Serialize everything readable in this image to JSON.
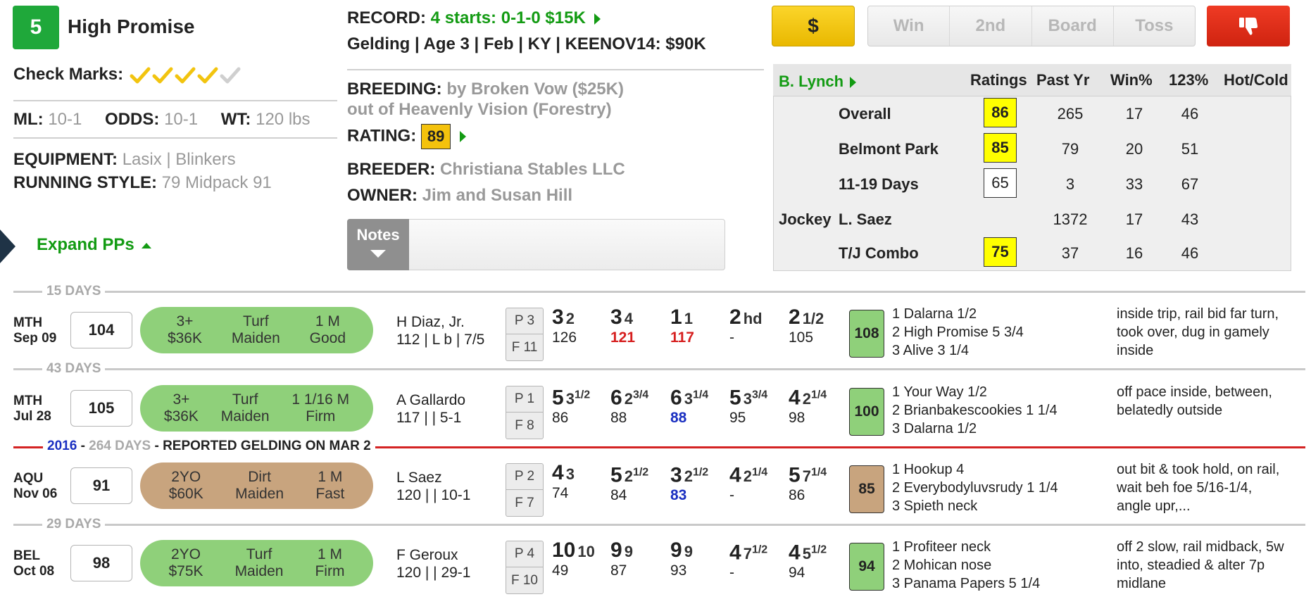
{
  "horse": {
    "program_number": "5",
    "name": "High Promise",
    "check_marks_label": "Check Marks:",
    "ml_label": "ML:",
    "ml": "10-1",
    "odds_label": "ODDS:",
    "odds": "10-1",
    "wt_label": "WT:",
    "wt": "120 lbs",
    "equipment_label": "EQUIPMENT:",
    "equipment": "Lasix | Blinkers",
    "running_style_label": "RUNNING STYLE:",
    "running_style": "79 Midpack 91",
    "expand_label": "Expand PPs"
  },
  "info": {
    "record_label": "RECORD:",
    "record": "4 starts: 0-1-0 $15K",
    "summary": "Gelding | Age 3 | Feb | KY | KEENOV14: $90K",
    "breeding_label": "BREEDING:",
    "breeding_1": "by Broken Vow ($25K)",
    "breeding_2": "out of Heavenly Vision (Forestry)",
    "rating_label": "RATING:",
    "rating": "89",
    "breeder_label": "BREEDER:",
    "breeder": "Christiana Stables LLC",
    "owner_label": "OWNER:",
    "owner": "Jim and Susan Hill",
    "notes_label": "Notes"
  },
  "buttons": {
    "dollar": "$",
    "win": "Win",
    "second": "2nd",
    "board": "Board",
    "toss": "Toss"
  },
  "trainer_panel": {
    "trainer": "B. Lynch",
    "headers": [
      "Ratings",
      "Past Yr",
      "Win%",
      "123%",
      "Hot/Cold"
    ],
    "rows": [
      {
        "label": "Overall",
        "rating": "86",
        "past_yr": "265",
        "win": "17",
        "itm": "46"
      },
      {
        "label": "Belmont Park",
        "rating": "85",
        "past_yr": "79",
        "win": "20",
        "itm": "51"
      },
      {
        "label": "11-19 Days",
        "rating": "65",
        "past_yr": "3",
        "win": "33",
        "itm": "67"
      },
      {
        "prefix": "Jockey",
        "label": "L. Saez",
        "rating": "",
        "past_yr": "1372",
        "win": "17",
        "itm": "43"
      },
      {
        "label": "T/J Combo",
        "rating": "75",
        "past_yr": "37",
        "win": "16",
        "itm": "46"
      }
    ]
  },
  "separators": {
    "s1": "15 DAYS",
    "s2": "43 DAYS",
    "year": "2016",
    "dash": "-",
    "s3_days": "264 DAYS",
    "s3_note": "- REPORTED GELDING ON MAR 2",
    "s4": "29 DAYS"
  },
  "races": [
    {
      "track": "MTH",
      "date": "Sep 09",
      "speed": "104",
      "pill": {
        "age": "3+",
        "purse": "$36K",
        "surface": "Turf",
        "type": "Maiden",
        "dist": "1 M",
        "cond": "Good"
      },
      "jockey": "H Diaz, Jr.",
      "weight_line": "112 | L b | 7/5",
      "post": "P 3",
      "field": "F 11",
      "calls": [
        {
          "pos": "3",
          "len": "2",
          "fig": "126"
        },
        {
          "pos": "3",
          "len": "4",
          "fig": "121"
        },
        {
          "pos": "1",
          "len": "1",
          "fig": "117"
        },
        {
          "pos": "2",
          "len": "hd",
          "fig": "-"
        },
        {
          "pos": "2",
          "len": "1/2",
          "fig": "105"
        }
      ],
      "figure": "108",
      "finish": [
        "1 Dalarna 1/2",
        "2 High Promise 5 3/4",
        "3 Alive 3 1/4"
      ],
      "comment": "inside trip, rail bid far turn, took over, dug in gamely inside"
    },
    {
      "track": "MTH",
      "date": "Jul 28",
      "speed": "105",
      "pill": {
        "age": "3+",
        "purse": "$36K",
        "surface": "Turf",
        "type": "Maiden",
        "dist": "1 1/16 M",
        "cond": "Firm"
      },
      "jockey": "A Gallardo",
      "weight_line": "117 | | 5-1",
      "post": "P 1",
      "field": "F 8",
      "calls": [
        {
          "pos": "5",
          "len": "3 1/2",
          "fig": "86"
        },
        {
          "pos": "6",
          "len": "2 3/4",
          "fig": "88"
        },
        {
          "pos": "6",
          "len": "3 1/4",
          "fig": "88"
        },
        {
          "pos": "5",
          "len": "3 3/4",
          "fig": "95"
        },
        {
          "pos": "4",
          "len": "2 1/4",
          "fig": "98"
        }
      ],
      "figure": "100",
      "finish": [
        "1 Your Way 1/2",
        "2 Brianbakescookies 1 1/4",
        "3 Dalarna 1/2"
      ],
      "comment": "off pace inside, between, belatedly outside"
    },
    {
      "track": "AQU",
      "date": "Nov 06",
      "speed": "91",
      "pill": {
        "age": "2YO",
        "purse": "$60K",
        "surface": "Dirt",
        "type": "Maiden",
        "dist": "1 M",
        "cond": "Fast"
      },
      "jockey": "L Saez",
      "weight_line": "120 | | 10-1",
      "post": "P 2",
      "field": "F 7",
      "calls": [
        {
          "pos": "4",
          "len": "3",
          "fig": "74"
        },
        {
          "pos": "5",
          "len": "2 1/2",
          "fig": "84"
        },
        {
          "pos": "3",
          "len": "2 1/2",
          "fig": "83"
        },
        {
          "pos": "4",
          "len": "2 1/4",
          "fig": "-"
        },
        {
          "pos": "5",
          "len": "7 1/4",
          "fig": "86"
        }
      ],
      "figure": "85",
      "finish": [
        "1 Hookup 4",
        "2 Everybodyluvsrudy 1 1/4",
        "3 Spieth neck"
      ],
      "comment": "out bit & took hold, on rail, wait beh foe 5/16-1/4, angle upr,..."
    },
    {
      "track": "BEL",
      "date": "Oct 08",
      "speed": "98",
      "pill": {
        "age": "2YO",
        "purse": "$75K",
        "surface": "Turf",
        "type": "Maiden",
        "dist": "1 M",
        "cond": "Firm"
      },
      "jockey": "F Geroux",
      "weight_line": "120 | | 29-1",
      "post": "P 4",
      "field": "F 10",
      "calls": [
        {
          "pos": "10",
          "len": "10",
          "fig": "49"
        },
        {
          "pos": "9",
          "len": "9",
          "fig": "87"
        },
        {
          "pos": "9",
          "len": "9",
          "fig": "93"
        },
        {
          "pos": "4",
          "len": "7 1/2",
          "fig": "-"
        },
        {
          "pos": "4",
          "len": "5 1/2",
          "fig": "94"
        }
      ],
      "figure": "94",
      "finish": [
        "1 Profiteer neck",
        "2 Mohican nose",
        "3 Panama Papers 5 1/4"
      ],
      "comment": "off 2 slow, rail midback, 5w into, steadied & alter 7p midlane"
    }
  ]
}
